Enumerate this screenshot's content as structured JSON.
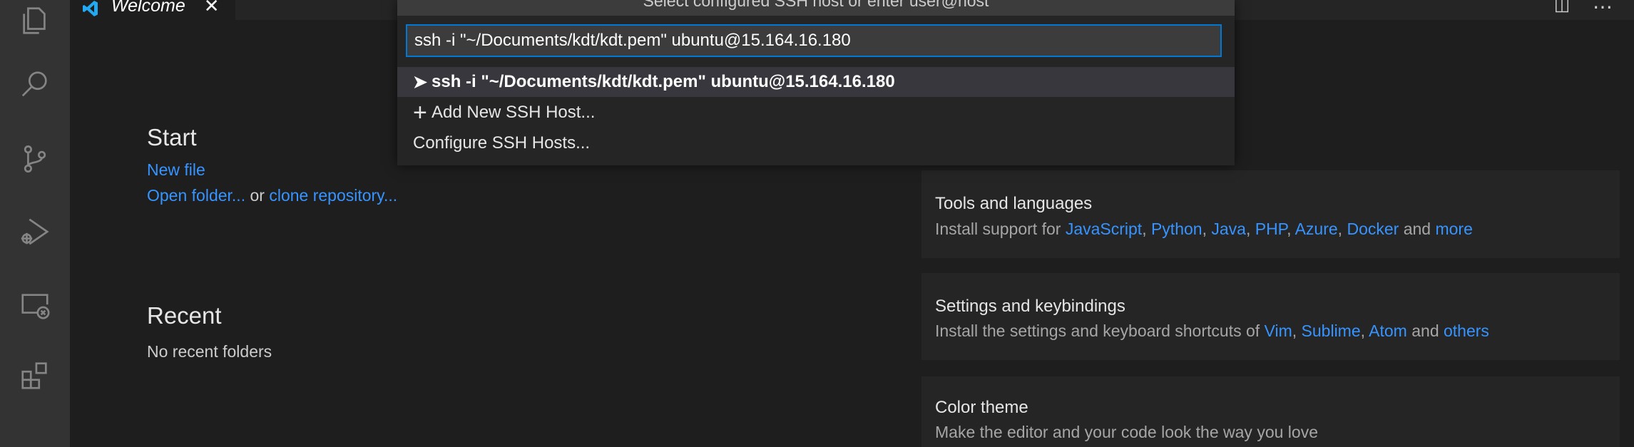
{
  "tab": {
    "title": "Welcome",
    "close_glyph": "✕",
    "icon": "vscode-logo-icon"
  },
  "editor_actions": {
    "split": "split-editor-icon",
    "more": "⋯"
  },
  "activity_bar": [
    "explorer-icon",
    "search-icon",
    "source-control-icon",
    "run-debug-icon",
    "remote-explorer-icon",
    "extensions-icon"
  ],
  "quick_pick": {
    "header": "Select configured SSH host or enter user@host",
    "input_value": "ssh -i \"~/Documents/kdt/kdt.pem\" ubuntu@15.164.16.180",
    "items": [
      {
        "glyph": "➤",
        "label": "ssh -i \"~/Documents/kdt/kdt.pem\" ubuntu@15.164.16.180"
      },
      {
        "glyph": "+",
        "label": "Add New SSH Host..."
      },
      {
        "glyph": "",
        "label": "Configure SSH Hosts..."
      }
    ]
  },
  "start": {
    "title": "Start",
    "new_file": "New file",
    "open_folder": "Open folder...",
    "or": "or",
    "clone_repo": "clone repository..."
  },
  "recent": {
    "title": "Recent",
    "empty": "No recent folders"
  },
  "cards": {
    "tools": {
      "title": "Tools and languages",
      "prefix": "Install support for",
      "links": [
        "JavaScript",
        "Python",
        "Java",
        "PHP",
        "Azure",
        "Docker"
      ],
      "and": "and",
      "more": "more"
    },
    "settings": {
      "title": "Settings and keybindings",
      "prefix": "Install the settings and keyboard shortcuts of",
      "links": [
        "Vim",
        "Sublime",
        "Atom"
      ],
      "and": "and",
      "others": "others"
    },
    "theme": {
      "title": "Color theme",
      "desc": "Make the editor and your code look the way you love"
    }
  },
  "colors": {
    "accent": "#0078d4",
    "link": "#3794ff",
    "background": "#1e1e1e",
    "activity_bar": "#333333"
  }
}
